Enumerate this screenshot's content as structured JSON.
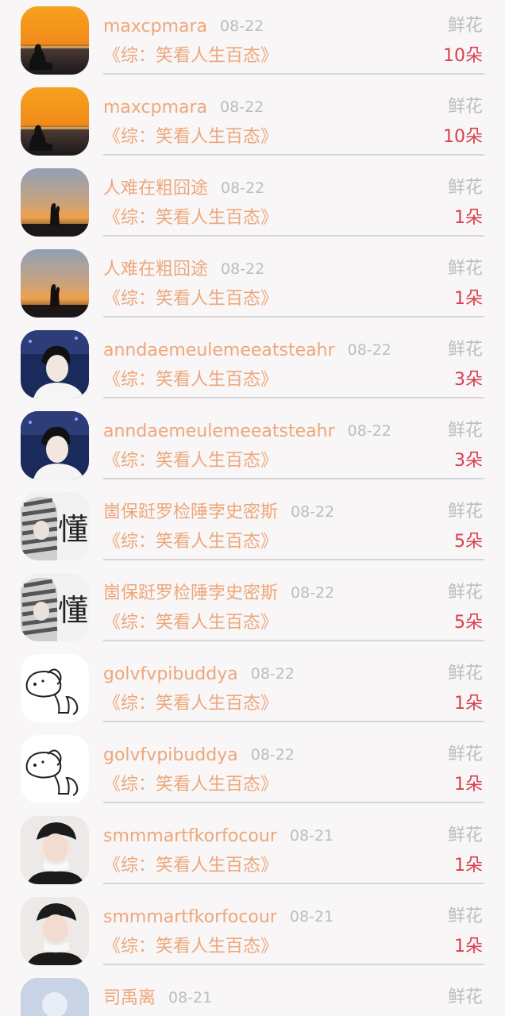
{
  "rows": [
    {
      "name": "maxcpmara",
      "date": "08-22",
      "title": "《综：笑看人生百态》",
      "gift": "鲜花",
      "count": "10朵",
      "avatar_icon": "sunset-meditation-avatar"
    },
    {
      "name": "maxcpmara",
      "date": "08-22",
      "title": "《综：笑看人生百态》",
      "gift": "鲜花",
      "count": "10朵",
      "avatar_icon": "sunset-meditation-avatar"
    },
    {
      "name": "人难在粗囧途",
      "date": "08-22",
      "title": "《综：笑看人生百态》",
      "gift": "鲜花",
      "count": "1朵",
      "avatar_icon": "sunset-couple-avatar"
    },
    {
      "name": "人难在粗囧途",
      "date": "08-22",
      "title": "《综：笑看人生百态》",
      "gift": "鲜花",
      "count": "1朵",
      "avatar_icon": "sunset-couple-avatar"
    },
    {
      "name": "anndaemeulemeeatsteahr",
      "date": "08-22",
      "title": "《综：笑看人生百态》",
      "gift": "鲜花",
      "count": "3朵",
      "avatar_icon": "young-man-avatar"
    },
    {
      "name": "anndaemeulemeeatsteahr",
      "date": "08-22",
      "title": "《综：笑看人生百态》",
      "gift": "鲜花",
      "count": "3朵",
      "avatar_icon": "young-man-avatar"
    },
    {
      "name": "崮保跹罗检陲孛史密斯",
      "date": "08-22",
      "title": "《综：笑看人生百态》",
      "gift": "鲜花",
      "count": "5朵",
      "avatar_icon": "striped-hoodie-avatar",
      "avatar_text": "懂"
    },
    {
      "name": "崮保跹罗检陲孛史密斯",
      "date": "08-22",
      "title": "《综：笑看人生百态》",
      "gift": "鲜花",
      "count": "5朵",
      "avatar_icon": "striped-hoodie-avatar",
      "avatar_text": "懂"
    },
    {
      "name": "golvfvpibuddya",
      "date": "08-22",
      "title": "《综：笑看人生百态》",
      "gift": "鲜花",
      "count": "1朵",
      "avatar_icon": "dog-doodle-avatar"
    },
    {
      "name": "golvfvpibuddya",
      "date": "08-22",
      "title": "《综：笑看人生百态》",
      "gift": "鲜花",
      "count": "1朵",
      "avatar_icon": "dog-doodle-avatar"
    },
    {
      "name": "smmmartfkorfocour",
      "date": "08-21",
      "title": "《综：笑看人生百态》",
      "gift": "鲜花",
      "count": "1朵",
      "avatar_icon": "person-with-cap-avatar"
    },
    {
      "name": "smmmartfkorfocour",
      "date": "08-21",
      "title": "《综：笑看人生百态》",
      "gift": "鲜花",
      "count": "1朵",
      "avatar_icon": "person-with-cap-avatar"
    },
    {
      "name": "司禹离",
      "date": "08-21",
      "title": "",
      "gift": "鲜花",
      "count": "",
      "avatar_icon": "default-user-avatar"
    }
  ],
  "colors": {
    "background": "#f8f6f7",
    "name_text": "#eda77a",
    "date_text": "#bdbdbd",
    "count_text": "#d9404e",
    "divider": "#d6d6d6"
  }
}
